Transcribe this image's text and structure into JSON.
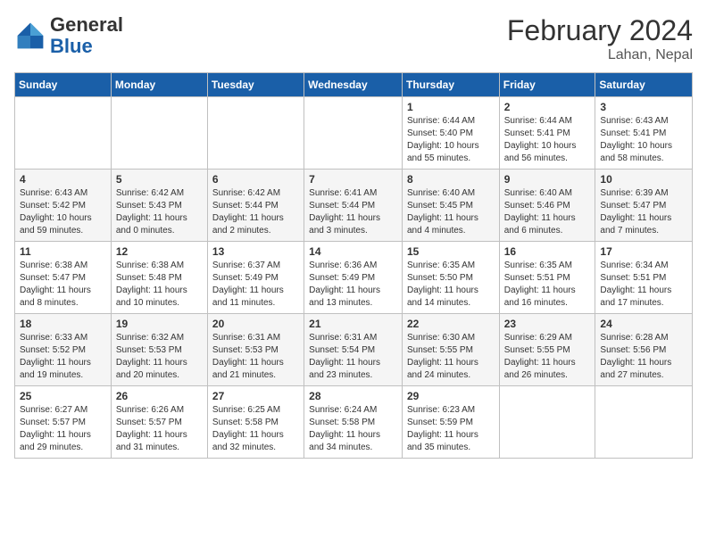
{
  "header": {
    "title": "February 2024",
    "subtitle": "Lahan, Nepal",
    "logo_general": "General",
    "logo_blue": "Blue"
  },
  "weekdays": [
    "Sunday",
    "Monday",
    "Tuesday",
    "Wednesday",
    "Thursday",
    "Friday",
    "Saturday"
  ],
  "weeks": [
    [
      {
        "day": "",
        "info": ""
      },
      {
        "day": "",
        "info": ""
      },
      {
        "day": "",
        "info": ""
      },
      {
        "day": "",
        "info": ""
      },
      {
        "day": "1",
        "info": "Sunrise: 6:44 AM\nSunset: 5:40 PM\nDaylight: 10 hours and 55 minutes."
      },
      {
        "day": "2",
        "info": "Sunrise: 6:44 AM\nSunset: 5:41 PM\nDaylight: 10 hours and 56 minutes."
      },
      {
        "day": "3",
        "info": "Sunrise: 6:43 AM\nSunset: 5:41 PM\nDaylight: 10 hours and 58 minutes."
      }
    ],
    [
      {
        "day": "4",
        "info": "Sunrise: 6:43 AM\nSunset: 5:42 PM\nDaylight: 10 hours and 59 minutes."
      },
      {
        "day": "5",
        "info": "Sunrise: 6:42 AM\nSunset: 5:43 PM\nDaylight: 11 hours and 0 minutes."
      },
      {
        "day": "6",
        "info": "Sunrise: 6:42 AM\nSunset: 5:44 PM\nDaylight: 11 hours and 2 minutes."
      },
      {
        "day": "7",
        "info": "Sunrise: 6:41 AM\nSunset: 5:44 PM\nDaylight: 11 hours and 3 minutes."
      },
      {
        "day": "8",
        "info": "Sunrise: 6:40 AM\nSunset: 5:45 PM\nDaylight: 11 hours and 4 minutes."
      },
      {
        "day": "9",
        "info": "Sunrise: 6:40 AM\nSunset: 5:46 PM\nDaylight: 11 hours and 6 minutes."
      },
      {
        "day": "10",
        "info": "Sunrise: 6:39 AM\nSunset: 5:47 PM\nDaylight: 11 hours and 7 minutes."
      }
    ],
    [
      {
        "day": "11",
        "info": "Sunrise: 6:38 AM\nSunset: 5:47 PM\nDaylight: 11 hours and 8 minutes."
      },
      {
        "day": "12",
        "info": "Sunrise: 6:38 AM\nSunset: 5:48 PM\nDaylight: 11 hours and 10 minutes."
      },
      {
        "day": "13",
        "info": "Sunrise: 6:37 AM\nSunset: 5:49 PM\nDaylight: 11 hours and 11 minutes."
      },
      {
        "day": "14",
        "info": "Sunrise: 6:36 AM\nSunset: 5:49 PM\nDaylight: 11 hours and 13 minutes."
      },
      {
        "day": "15",
        "info": "Sunrise: 6:35 AM\nSunset: 5:50 PM\nDaylight: 11 hours and 14 minutes."
      },
      {
        "day": "16",
        "info": "Sunrise: 6:35 AM\nSunset: 5:51 PM\nDaylight: 11 hours and 16 minutes."
      },
      {
        "day": "17",
        "info": "Sunrise: 6:34 AM\nSunset: 5:51 PM\nDaylight: 11 hours and 17 minutes."
      }
    ],
    [
      {
        "day": "18",
        "info": "Sunrise: 6:33 AM\nSunset: 5:52 PM\nDaylight: 11 hours and 19 minutes."
      },
      {
        "day": "19",
        "info": "Sunrise: 6:32 AM\nSunset: 5:53 PM\nDaylight: 11 hours and 20 minutes."
      },
      {
        "day": "20",
        "info": "Sunrise: 6:31 AM\nSunset: 5:53 PM\nDaylight: 11 hours and 21 minutes."
      },
      {
        "day": "21",
        "info": "Sunrise: 6:31 AM\nSunset: 5:54 PM\nDaylight: 11 hours and 23 minutes."
      },
      {
        "day": "22",
        "info": "Sunrise: 6:30 AM\nSunset: 5:55 PM\nDaylight: 11 hours and 24 minutes."
      },
      {
        "day": "23",
        "info": "Sunrise: 6:29 AM\nSunset: 5:55 PM\nDaylight: 11 hours and 26 minutes."
      },
      {
        "day": "24",
        "info": "Sunrise: 6:28 AM\nSunset: 5:56 PM\nDaylight: 11 hours and 27 minutes."
      }
    ],
    [
      {
        "day": "25",
        "info": "Sunrise: 6:27 AM\nSunset: 5:57 PM\nDaylight: 11 hours and 29 minutes."
      },
      {
        "day": "26",
        "info": "Sunrise: 6:26 AM\nSunset: 5:57 PM\nDaylight: 11 hours and 31 minutes."
      },
      {
        "day": "27",
        "info": "Sunrise: 6:25 AM\nSunset: 5:58 PM\nDaylight: 11 hours and 32 minutes."
      },
      {
        "day": "28",
        "info": "Sunrise: 6:24 AM\nSunset: 5:58 PM\nDaylight: 11 hours and 34 minutes."
      },
      {
        "day": "29",
        "info": "Sunrise: 6:23 AM\nSunset: 5:59 PM\nDaylight: 11 hours and 35 minutes."
      },
      {
        "day": "",
        "info": ""
      },
      {
        "day": "",
        "info": ""
      }
    ]
  ]
}
